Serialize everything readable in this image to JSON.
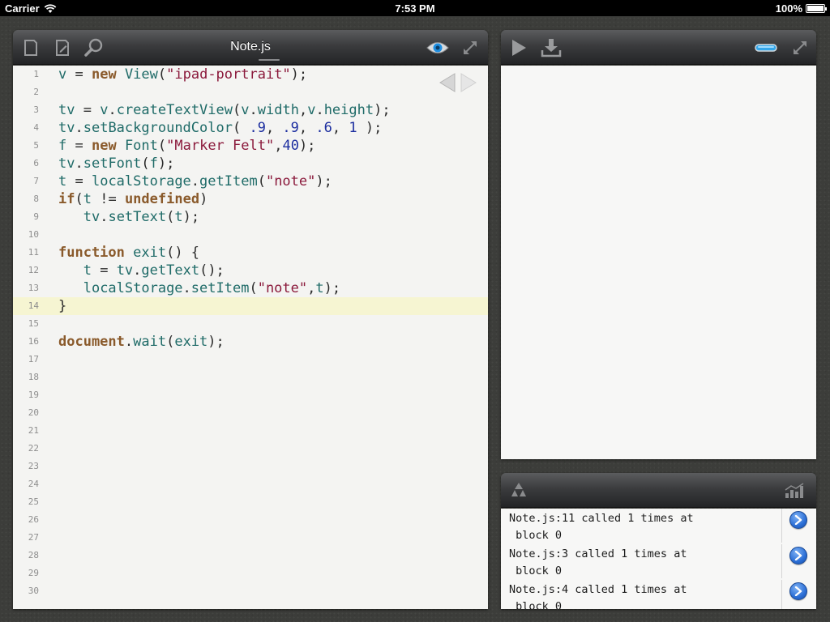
{
  "status_bar": {
    "carrier": "Carrier",
    "time": "7:53 PM",
    "battery": "100%"
  },
  "editor": {
    "title": "Note.js",
    "icons": [
      "new-file-icon",
      "edit-icon",
      "search-icon",
      "eye-icon",
      "expand-icon"
    ],
    "current_line": 14,
    "lines": [
      {
        "n": "1",
        "code": "v = new View(\"ipad-portrait\");"
      },
      {
        "n": "2",
        "code": ""
      },
      {
        "n": "3",
        "code": "tv = v.createTextView(v.width,v.height);"
      },
      {
        "n": "4",
        "code": "tv.setBackgroundColor( .9, .9, .6, 1 );"
      },
      {
        "n": "5",
        "code": "f = new Font(\"Marker Felt\",40);"
      },
      {
        "n": "6",
        "code": "tv.setFont(f);"
      },
      {
        "n": "7",
        "code": "t = localStorage.getItem(\"note\");"
      },
      {
        "n": "8",
        "code": "if(t != undefined)"
      },
      {
        "n": "9",
        "code": "   tv.setText(t);"
      },
      {
        "n": "10",
        "code": ""
      },
      {
        "n": "11",
        "code": "function exit() {"
      },
      {
        "n": "12",
        "code": "   t = tv.getText();"
      },
      {
        "n": "13",
        "code": "   localStorage.setItem(\"note\",t);"
      },
      {
        "n": "14",
        "code": "}"
      },
      {
        "n": "15",
        "code": ""
      },
      {
        "n": "16",
        "code": "document.wait(exit);"
      },
      {
        "n": "17",
        "code": ""
      },
      {
        "n": "18",
        "code": ""
      },
      {
        "n": "19",
        "code": ""
      },
      {
        "n": "20",
        "code": ""
      },
      {
        "n": "21",
        "code": ""
      },
      {
        "n": "22",
        "code": ""
      },
      {
        "n": "23",
        "code": ""
      },
      {
        "n": "24",
        "code": ""
      },
      {
        "n": "25",
        "code": ""
      },
      {
        "n": "26",
        "code": ""
      },
      {
        "n": "27",
        "code": ""
      },
      {
        "n": "28",
        "code": ""
      },
      {
        "n": "29",
        "code": ""
      },
      {
        "n": "30",
        "code": ""
      }
    ]
  },
  "preview": {
    "icons": [
      "play-icon",
      "download-icon",
      "toggle-icon",
      "expand-icon"
    ]
  },
  "console": {
    "icons": [
      "recycle-icon",
      "chart-icon"
    ],
    "entries": [
      {
        "line1": "Note.js:11 called 1 times at",
        "line2": " block 0"
      },
      {
        "line1": "Note.js:3 called 1 times at",
        "line2": " block 0"
      },
      {
        "line1": "Note.js:4 called 1 times at",
        "line2": " block 0"
      }
    ]
  },
  "colors": {
    "keyword": "#8a5a2b",
    "identifier": "#1f6b68",
    "string": "#8b1a3c",
    "number": "#1d2fa0",
    "current_line": "#f6f5d2",
    "accent": "#2c6fd6"
  }
}
